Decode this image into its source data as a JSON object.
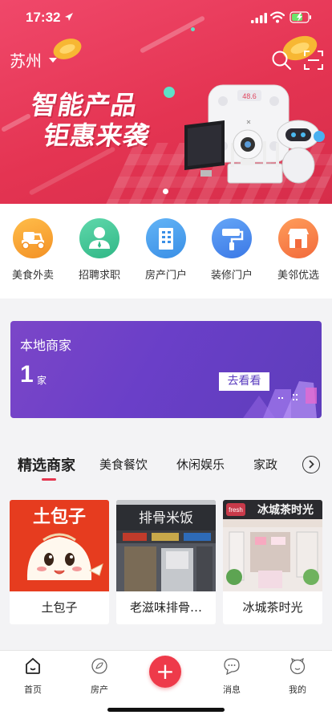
{
  "status": {
    "time": "17:32"
  },
  "header": {
    "city": "苏州"
  },
  "banner": {
    "title_line1": "智能产品",
    "title_line2": "钜惠来袭",
    "scale_reading": "48.6"
  },
  "categories": [
    {
      "label": "美食外卖",
      "color": "#f7a23a",
      "icon": "scooter-icon"
    },
    {
      "label": "招聘求职",
      "color": "#41c79a",
      "icon": "person-icon"
    },
    {
      "label": "房产门户",
      "color": "#4aa2ee",
      "icon": "building-icon"
    },
    {
      "label": "装修门户",
      "color": "#4f8ff0",
      "icon": "paint-roller-icon"
    },
    {
      "label": "美邻优选",
      "color": "#f6834c",
      "icon": "store-icon"
    }
  ],
  "local": {
    "title": "本地商家",
    "count": "1",
    "unit": "家",
    "go_label": "去看看"
  },
  "tabs": [
    {
      "label": "精选商家",
      "active": true
    },
    {
      "label": "美食餐饮"
    },
    {
      "label": "休闲娱乐"
    },
    {
      "label": "家政"
    }
  ],
  "merchants": [
    {
      "name": "土包子",
      "sign": "土包子"
    },
    {
      "name": "老滋味排骨…",
      "sign": "排骨米饭"
    },
    {
      "name": "冰城茶时光",
      "sign": "冰城茶时光",
      "brand": "fresh"
    }
  ],
  "tabbar": {
    "home": "首页",
    "house": "房产",
    "messages": "消息",
    "mine": "我的",
    "add": "+"
  }
}
